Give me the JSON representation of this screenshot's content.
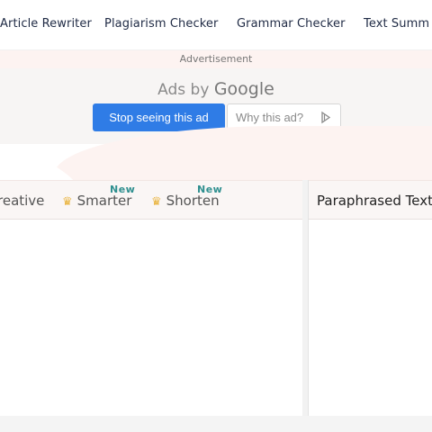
{
  "nav": {
    "items": [
      "Article Rewriter",
      "Plagiarism Checker",
      "Grammar Checker",
      "Text Summ"
    ]
  },
  "ad": {
    "label": "Advertisement",
    "ads_by": "Ads by",
    "brand": "Google",
    "stop_button": "Stop seeing this ad",
    "why_button": "Why this ad?"
  },
  "editor": {
    "modes": [
      {
        "label": "reative",
        "badge": ""
      },
      {
        "label": "Smarter",
        "badge": "New"
      },
      {
        "label": "Shorten",
        "badge": "New"
      }
    ],
    "output_title": "Paraphrased Text",
    "colors": {
      "accent": "#2f7ce6",
      "crown": "#e9b33c",
      "badge": "#2f8f8f"
    }
  }
}
